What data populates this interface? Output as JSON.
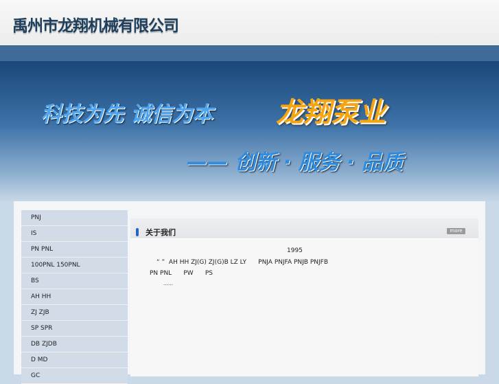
{
  "header": {
    "company_name": "禹州市龙翔机械有限公司"
  },
  "banner": {
    "slogan1": "科技为先  诚信为本",
    "brand": "龙翔泵业",
    "slogan2": "—— 创新 · 服务 · 品质"
  },
  "sidebar": {
    "items": [
      {
        "label": "PNJ"
      },
      {
        "label": "IS"
      },
      {
        "label": "PN PNL"
      },
      {
        "label": "100PNL 150PNL"
      },
      {
        "label": "BS"
      },
      {
        "label": "AH HH"
      },
      {
        "label": "ZJ ZJB"
      },
      {
        "label": "SP SPR"
      },
      {
        "label": "DB ZJDB"
      },
      {
        "label": "D MD"
      },
      {
        "label": "GC"
      }
    ]
  },
  "about": {
    "title": "关于我们",
    "more": "more",
    "line1": "1995",
    "line2": "“ ”  AH HH ZJ(G) ZJ(G)B LZ LY      PNJA PNJFA PNJB PNJFB",
    "line3": "PN PNL      PW      PS",
    "line4": "……"
  }
}
